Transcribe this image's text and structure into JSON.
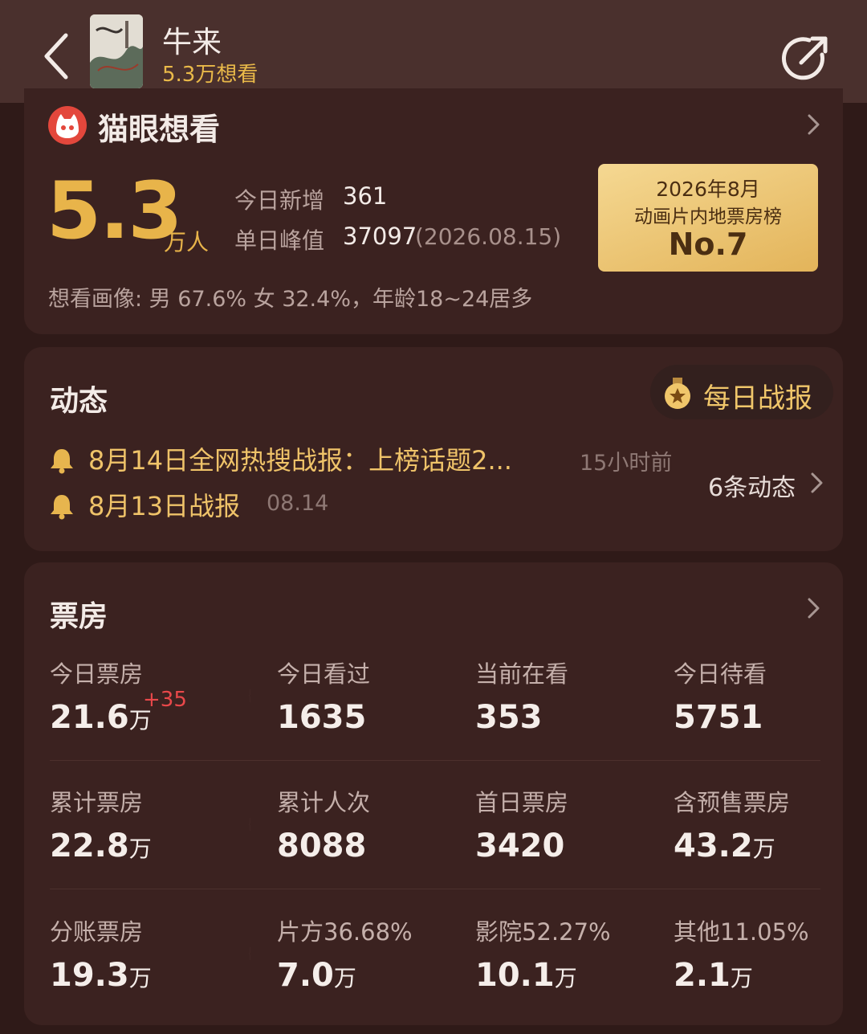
{
  "header": {
    "title": "牛来",
    "want_count": "5.3万想看"
  },
  "maoyan": {
    "title": "猫眼想看",
    "big_number": "5.3",
    "big_unit": "万人",
    "today_new_label": "今日新增",
    "today_new_value": "361",
    "peak_label": "单日峰值",
    "peak_value": "37097",
    "peak_date": "(2026.08.15)",
    "portrait": "想看画像: 男 67.6%  女 32.4%，年龄18~24居多",
    "rank": {
      "line1": "2026年8月",
      "line2": "动画片内地票房榜",
      "line3": "No.7"
    }
  },
  "dynamics": {
    "title": "动态",
    "daily_report": "每日战报",
    "items": [
      {
        "text": "8月14日全网热搜战报：上榜话题2...",
        "time": "15小时前"
      },
      {
        "text": "8月13日战报",
        "time": "08.14"
      }
    ],
    "more": "6条动态"
  },
  "box_office": {
    "title": "票房",
    "rows": [
      [
        {
          "label": "今日票房",
          "value": "21.6",
          "unit": "万",
          "delta": "+35"
        },
        {
          "label": "今日看过",
          "value": "1635",
          "unit": ""
        },
        {
          "label": "当前在看",
          "value": "353",
          "unit": ""
        },
        {
          "label": "今日待看",
          "value": "5751",
          "unit": ""
        }
      ],
      [
        {
          "label": "累计票房",
          "value": "22.8",
          "unit": "万"
        },
        {
          "label": "累计人次",
          "value": "8088",
          "unit": ""
        },
        {
          "label": "首日票房",
          "value": "3420",
          "unit": ""
        },
        {
          "label": "含预售票房",
          "value": "43.2",
          "unit": "万"
        }
      ],
      [
        {
          "label": "分账票房",
          "value": "19.3",
          "unit": "万"
        },
        {
          "label": "片方36.68%",
          "value": "7.0",
          "unit": "万"
        },
        {
          "label": "影院52.27%",
          "value": "10.1",
          "unit": "万"
        },
        {
          "label": "其他11.05%",
          "value": "2.1",
          "unit": "万"
        }
      ]
    ]
  },
  "colors": {
    "background": "#2f1a18",
    "card": "#3b2220",
    "accent_gold": "#e8b44a",
    "news_gold": "#efc369",
    "delta_red": "#e9484a"
  },
  "icons": [
    "back-icon",
    "share-icon",
    "maoyan-cat-icon",
    "chevron-right-icon",
    "medal-icon",
    "bell-icon"
  ]
}
